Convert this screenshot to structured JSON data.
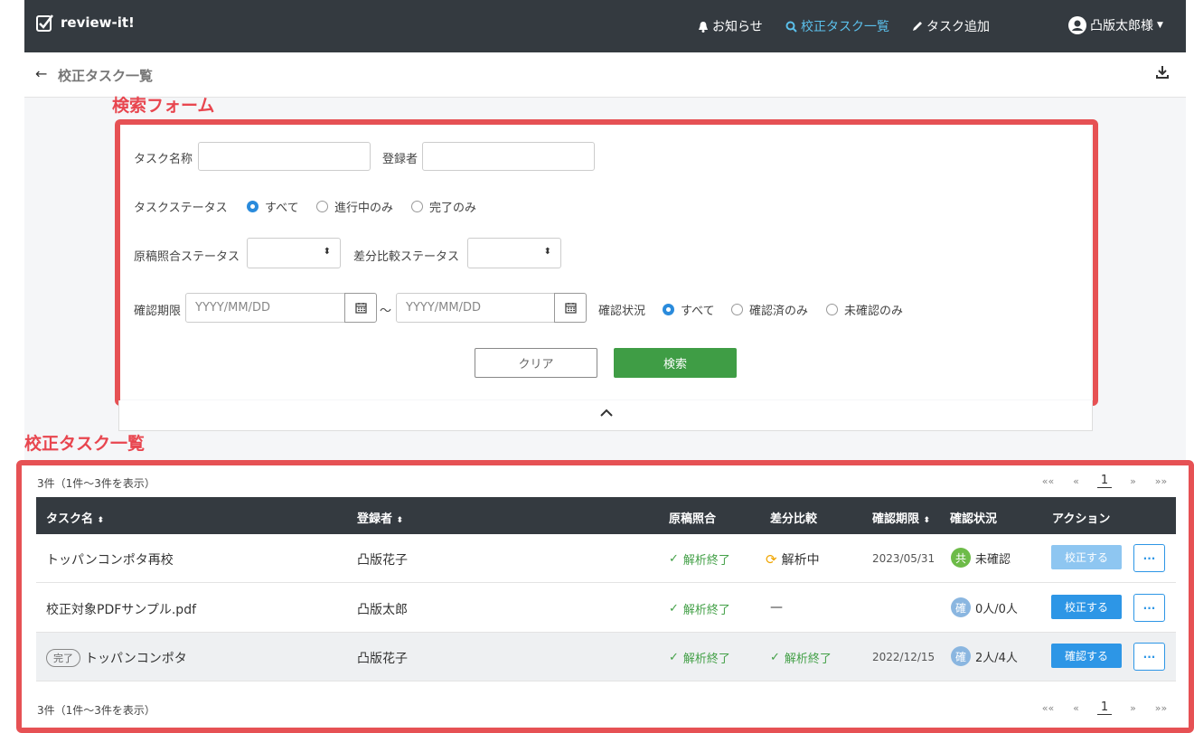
{
  "navbar": {
    "brand": "review-it!",
    "notifications": "お知らせ",
    "task_list": "校正タスク一覧",
    "add_task": "タスク追加",
    "user": "凸版太郎様"
  },
  "subheader": {
    "title": "校正タスク一覧"
  },
  "annotations": {
    "search_form": "検索フォーム",
    "task_list": "校正タスク一覧",
    "color": "#e65154"
  },
  "search_form": {
    "task_name_label": "タスク名称",
    "registrant_label": "登録者",
    "task_status_label": "タスクステータス",
    "task_status_options": [
      "すべて",
      "進行中のみ",
      "完了のみ"
    ],
    "manuscript_status_label": "原稿照合ステータス",
    "diff_status_label": "差分比較ステータス",
    "deadline_label": "確認期限",
    "date_placeholder": "YYYY/MM/DD",
    "range_sep": "～",
    "confirm_status_label": "確認状況",
    "confirm_status_options": [
      "すべて",
      "確認済のみ",
      "未確認のみ"
    ],
    "clear": "クリア",
    "search": "検索"
  },
  "list": {
    "count_text": "3件（1件～3件を表示）",
    "pager": {
      "first": "««",
      "prev": "«",
      "current": "1",
      "next": "»",
      "last": "»»"
    },
    "columns": [
      "タスク名",
      "登録者",
      "原稿照合",
      "差分比較",
      "確認期限",
      "確認状況",
      "アクション"
    ],
    "rows": [
      {
        "name": "トッパンコンポタ再校",
        "registrant": "凸版花子",
        "manuscript": "解析終了",
        "diff": "解析中",
        "deadline": "2023/05/31",
        "status_badge": "共",
        "status_text": "未確認",
        "action": "校正する",
        "done_tag": ""
      },
      {
        "name": "校正対象PDFサンプル.pdf",
        "registrant": "凸版太郎",
        "manuscript": "解析終了",
        "diff": "—",
        "deadline": "",
        "status_badge": "確",
        "status_text": "0人/0人",
        "action": "校正する",
        "done_tag": ""
      },
      {
        "name": "トッパンコンポタ",
        "registrant": "凸版花子",
        "manuscript": "解析終了",
        "diff": "解析終了",
        "deadline": "2022/12/15",
        "status_badge": "確",
        "status_text": "2人/4人",
        "action": "確認する",
        "done_tag": "完了"
      }
    ],
    "more": "···"
  }
}
